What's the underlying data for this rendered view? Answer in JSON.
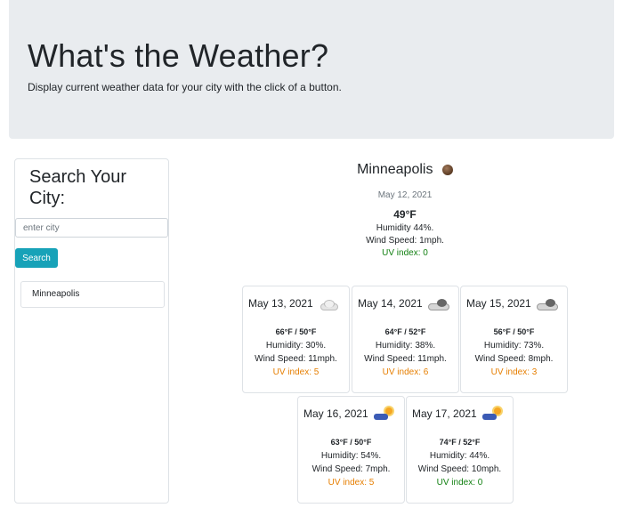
{
  "header": {
    "title": "What's the Weather?",
    "subtitle": "Display current weather data for your city with the click of a button."
  },
  "search": {
    "heading": "Search Your City:",
    "placeholder": "enter city",
    "button_label": "Search",
    "history": [
      "Minneapolis"
    ]
  },
  "current": {
    "city": "Minneapolis",
    "icon": "sun-icon",
    "date": "May 12, 2021",
    "temp": "49°F",
    "humidity": "Humidity 44%.",
    "wind": "Wind Speed: 1mph.",
    "uv": "UV index: 0",
    "uv_color": "#128012"
  },
  "forecast": [
    {
      "date": "May 13, 2021",
      "icon": "cloud-icon",
      "temp": "66°F / 50°F",
      "humidity": "Humidity: 30%.",
      "wind": "Wind Speed: 11mph.",
      "uv": "UV index: 5",
      "uv_color": "#e67e00"
    },
    {
      "date": "May 14, 2021",
      "icon": "rain-cloud-icon",
      "temp": "64°F / 52°F",
      "humidity": "Humidity: 38%.",
      "wind": "Wind Speed: 11mph.",
      "uv": "UV index: 6",
      "uv_color": "#e67e00"
    },
    {
      "date": "May 15, 2021",
      "icon": "rain-cloud-icon",
      "temp": "56°F / 50°F",
      "humidity": "Humidity: 73%.",
      "wind": "Wind Speed: 8mph.",
      "uv": "UV index: 3",
      "uv_color": "#e67e00"
    },
    {
      "date": "May 16, 2021",
      "icon": "storm-icon",
      "temp": "63°F / 50°F",
      "humidity": "Humidity: 54%.",
      "wind": "Wind Speed: 7mph.",
      "uv": "UV index: 5",
      "uv_color": "#e67e00"
    },
    {
      "date": "May 17, 2021",
      "icon": "storm-icon",
      "temp": "74°F / 52°F",
      "humidity": "Humidity: 44%.",
      "wind": "Wind Speed: 10mph.",
      "uv": "UV index: 0",
      "uv_color": "#128012"
    }
  ]
}
